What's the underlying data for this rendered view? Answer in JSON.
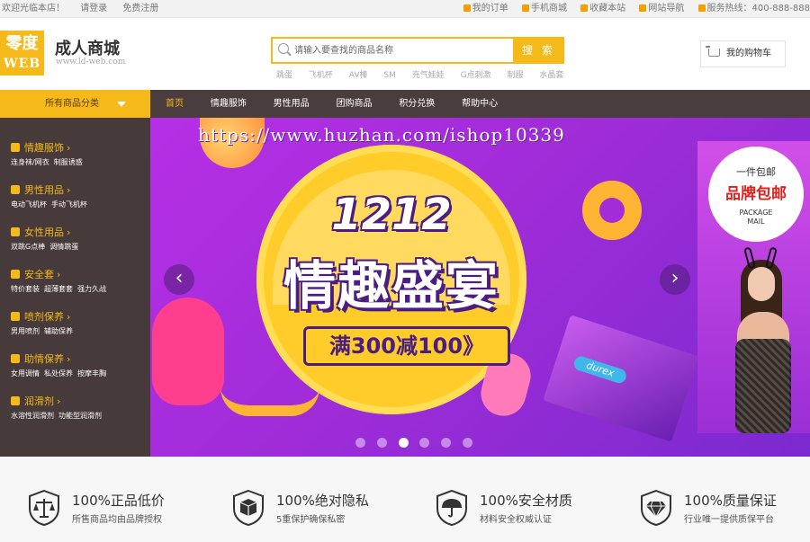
{
  "topbar": {
    "welcome": "欢迎光临本店！",
    "login": "请登录",
    "register": "免费注册",
    "links": [
      "我的订单",
      "手机商城",
      "收藏本站",
      "网站导航"
    ],
    "hotline": "服务热线：400-888-888"
  },
  "header": {
    "logo_line1": "零度",
    "logo_line2": "WEB",
    "brand": "成人商城",
    "brand_url": "www.ld-web.com",
    "search_placeholder": "请输入要查找的商品名称",
    "search_button": "搜 索",
    "hot_words": [
      "跳蛋",
      "飞机杯",
      "AV棒",
      "SM",
      "充气娃娃",
      "G点刺激",
      "制服",
      "水晶套"
    ],
    "cart": "我的购物车"
  },
  "nav": {
    "all_categories": "所有商品分类",
    "items": [
      "首页",
      "情趣服饰",
      "男性用品",
      "团购商品",
      "积分兑换",
      "帮助中心"
    ],
    "active_index": 0
  },
  "categories": [
    {
      "title": "情趣服饰",
      "subs": [
        "连身袜/网衣",
        "制服诱惑"
      ]
    },
    {
      "title": "男性用品",
      "subs": [
        "电动飞机杯",
        "手动飞机杯"
      ]
    },
    {
      "title": "女性用品",
      "subs": [
        "双跳G点棒",
        "调情跳蛋"
      ]
    },
    {
      "title": "安全套",
      "subs": [
        "特价套装",
        "超薄套套",
        "强力久战"
      ]
    },
    {
      "title": "喷剂保养",
      "subs": [
        "男用喷剂",
        "辅助保养"
      ]
    },
    {
      "title": "助情保养",
      "subs": [
        "女用调情",
        "私处保养",
        "按摩丰胸"
      ]
    },
    {
      "title": "润滑剂",
      "subs": [
        "水溶性润滑剂",
        "功能型润滑剂"
      ]
    }
  ],
  "banner": {
    "number": "1212",
    "title": "情趣盛宴",
    "promo": "满300减100》",
    "product_label": "durex",
    "badge_line1": "一件包邮",
    "badge_line2": "品牌包邮",
    "badge_line3": "PACKAGE",
    "badge_line4": "MAIL",
    "prev": "‹",
    "next": "›",
    "slide_count": 6,
    "active_slide": 2
  },
  "watermark": "https://www.huzhan.com/ishop10339",
  "features": [
    {
      "title": "100%正品低价",
      "subtitle": "所售商品均由品牌授权",
      "icon": "scale-icon"
    },
    {
      "title": "100%绝对隐私",
      "subtitle": "5重保护确保私密",
      "icon": "box-icon"
    },
    {
      "title": "100%安全材质",
      "subtitle": "材料安全权威认证",
      "icon": "umbrella-icon"
    },
    {
      "title": "100%质量保证",
      "subtitle": "行业唯一提供质保平台",
      "icon": "diamond-icon"
    }
  ],
  "colors": {
    "accent": "#f6b91a",
    "nav_bg": "#4a3d3d",
    "sidebar_bg": "#463a3a",
    "banner": "#a02cd8"
  }
}
